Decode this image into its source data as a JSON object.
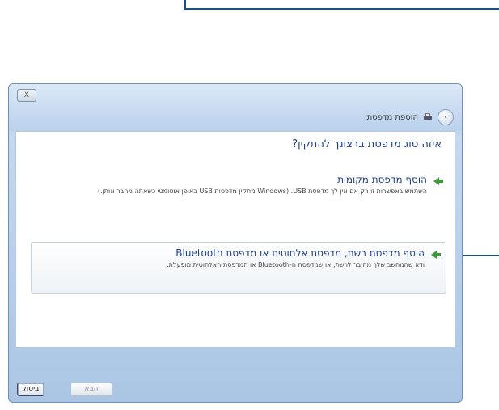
{
  "window": {
    "title": "הוספת מדפסת",
    "close_label": "X"
  },
  "question": "איזה סוג מדפסת ברצונך להתקין?",
  "options": [
    {
      "title": "הוסף מדפסת מקומית",
      "description": "השתמש באפשרות זו רק אם אין לך מדפסת USB. (Windows מתקין מדפסות USB באופן אוטומטי כשאתה מחבר אותן.)"
    },
    {
      "title": "הוסף מדפסת רשת, מדפסת אלחוטית או מדפסת Bluetooth",
      "description": "ודא שהמחשב שלך מחובר לרשת, או שמדפסת ה-Bluetooth או המדפסת האלחוטית מופעלת."
    }
  ],
  "buttons": {
    "next": "הבא",
    "cancel": "ביטול"
  },
  "icons": {
    "back": "back-arrow-icon",
    "printer": "printer-icon",
    "option": "green-arrow-icon"
  },
  "colors": {
    "accent": "#1f4e79",
    "link": "#1e3f8a",
    "option_arrow": "#3a9a3a"
  }
}
